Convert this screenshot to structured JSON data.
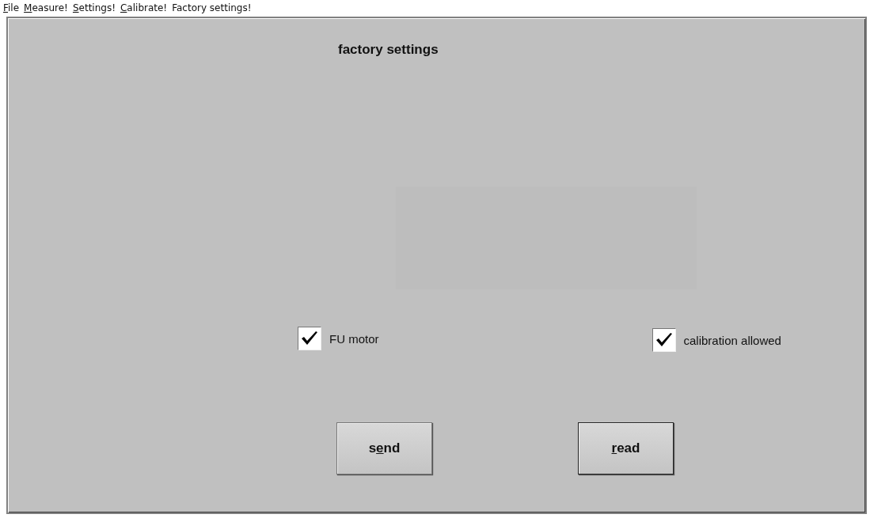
{
  "menu": [
    {
      "mnemonic": "F",
      "after": "ile"
    },
    {
      "mnemonic": "M",
      "after": "easure!"
    },
    {
      "mnemonic": "S",
      "after": "ettings!"
    },
    {
      "mnemonic": "C",
      "after": "alibrate!"
    },
    {
      "before": "Factory settings!"
    }
  ],
  "title": "factory settings",
  "checkboxes": [
    {
      "label": "FU motor",
      "checked": true
    },
    {
      "label": "calibration allowed",
      "checked": true
    }
  ],
  "buttons": [
    {
      "before": "s",
      "mnemonic": "e",
      "after": "nd",
      "selected": false
    },
    {
      "mnemonic": "r",
      "after": "ead",
      "selected": true
    }
  ]
}
